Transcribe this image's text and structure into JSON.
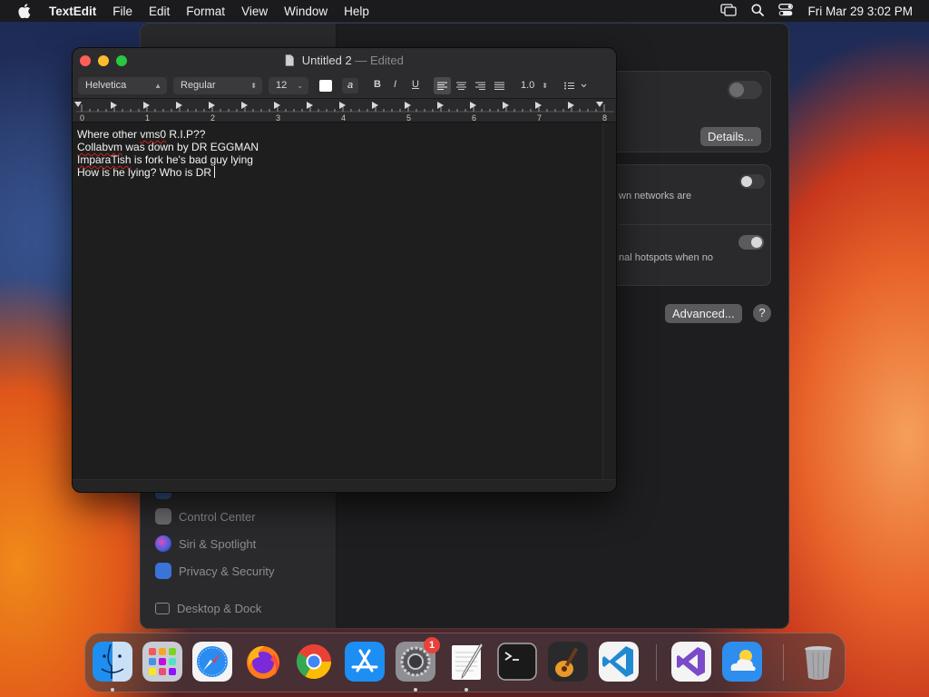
{
  "menubar": {
    "app_name": "TextEdit",
    "items": [
      "File",
      "Edit",
      "Format",
      "View",
      "Window",
      "Help"
    ],
    "clock": "Fri Mar 29  3:02 PM"
  },
  "settings": {
    "sidebar_items": [
      {
        "label": "Control Center",
        "icon": "control-center-icon"
      },
      {
        "label": "Siri & Spotlight",
        "icon": "siri-icon"
      },
      {
        "label": "Privacy & Security",
        "icon": "privacy-hand-icon"
      },
      {
        "label": "Desktop & Dock",
        "icon": "desktop-dock-icon"
      }
    ],
    "details_button": "Details...",
    "advanced_button": "Advanced...",
    "help_button": "?",
    "text_known_networks": "wn networks are",
    "text_hotspots": "nal hotspots when no"
  },
  "textedit": {
    "title": "Untitled 2",
    "title_separator": "—",
    "edited_label": "Edited",
    "toolbar": {
      "font_family": "Helvetica",
      "font_style": "Regular",
      "font_size": "12",
      "bold": "B",
      "italic": "I",
      "underline": "U",
      "line_spacing": "1.0",
      "text_color_sample": "a"
    },
    "ruler_numbers": [
      "0",
      "1",
      "2",
      "3",
      "4",
      "5",
      "6",
      "7",
      "8"
    ],
    "lines": [
      {
        "parts": [
          {
            "text": "Where other ",
            "err": false
          },
          {
            "text": "vms0",
            "err": true
          },
          {
            "text": " R.I.P??",
            "err": false
          }
        ]
      },
      {
        "parts": [
          {
            "text": "Collabvm",
            "err": true
          },
          {
            "text": " was down by DR EGGMAN",
            "err": false
          }
        ]
      },
      {
        "parts": [
          {
            "text": "ImparaTish",
            "err": true
          },
          {
            "text": " is fork he's bad guy lying",
            "err": false
          }
        ]
      },
      {
        "parts": [
          {
            "text": "How is he lying? Who is DR",
            "err": false
          }
        ]
      }
    ]
  },
  "dock": {
    "apps": [
      {
        "name": "Finder",
        "icon": "finder-icon",
        "running": true
      },
      {
        "name": "Launchpad",
        "icon": "launchpad-icon",
        "running": false
      },
      {
        "name": "Safari",
        "icon": "safari-icon",
        "running": false
      },
      {
        "name": "Firefox",
        "icon": "firefox-icon",
        "running": false
      },
      {
        "name": "Chrome",
        "icon": "chrome-icon",
        "running": false
      },
      {
        "name": "App Store",
        "icon": "app-store-icon",
        "running": false
      },
      {
        "name": "System Settings",
        "icon": "system-settings-icon",
        "running": true,
        "badge": "1"
      },
      {
        "name": "TextEdit",
        "icon": "textedit-icon",
        "running": true
      },
      {
        "name": "Terminal",
        "icon": "terminal-icon",
        "running": false
      },
      {
        "name": "GarageBand",
        "icon": "garageband-icon",
        "running": false
      },
      {
        "name": "VS Code",
        "icon": "vscode-icon",
        "running": false
      },
      {
        "name": "Visual Studio",
        "icon": "visual-studio-icon",
        "running": false
      },
      {
        "name": "Weather",
        "icon": "weather-icon",
        "running": false
      },
      {
        "name": "Trash",
        "icon": "trash-icon",
        "running": false
      }
    ]
  },
  "colors": {
    "accent_red": "#ff5f57",
    "accent_yellow": "#febc2e",
    "accent_green": "#28c840",
    "badge": "#e8423a"
  }
}
